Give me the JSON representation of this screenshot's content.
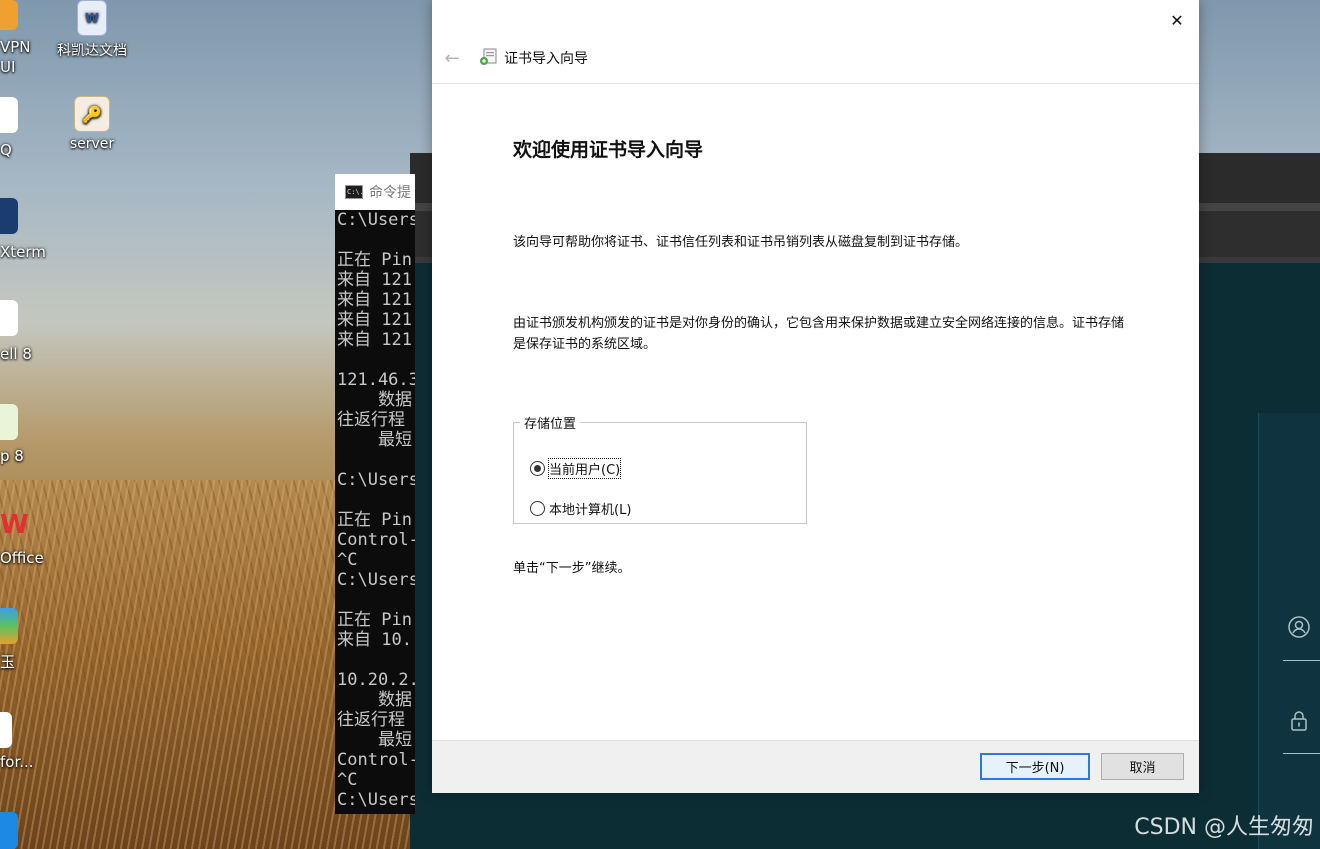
{
  "desktop": {
    "icons": [
      {
        "label": "科凯达文档",
        "icon": "word-document-icon"
      },
      {
        "label": "server",
        "icon": "certificate-file-icon"
      }
    ],
    "cut_labels": [
      "VPN",
      "UI",
      "Q",
      "Xterm",
      "ell 8",
      "p 8",
      "Office",
      "玉",
      "for..."
    ]
  },
  "console": {
    "title": "命令提",
    "icon_text": "C:\\.",
    "lines": [
      "C:\\Users",
      "",
      "正在 Pin",
      "来自 121",
      "来自 121",
      "来自 121",
      "来自 121",
      "",
      "121.46.3",
      "    数据",
      "往返行程",
      "    最短",
      "",
      "C:\\Users",
      "",
      "正在 Pin",
      "Control-",
      "^C",
      "C:\\Users",
      "",
      "正在 Pin",
      "来自 10.",
      "",
      "10.20.2.",
      "    数据",
      "往返行程",
      "    最短",
      "Control-",
      "^C",
      "C:\\Users"
    ]
  },
  "wizard": {
    "close_symbol": "✕",
    "back_symbol": "←",
    "nav_title": "证书导入向导",
    "heading": "欢迎使用证书导入向导",
    "paragraph1": "该向导可帮助你将证书、证书信任列表和证书吊销列表从磁盘复制到证书存储。",
    "paragraph2": "由证书颁发机构颁发的证书是对你身份的确认，它包含用来保护数据或建立安全网络连接的信息。证书存储是保存证书的系统区域。",
    "store_location": {
      "legend": "存储位置",
      "options": [
        {
          "label": "当前用户(C)",
          "selected": true
        },
        {
          "label": "本地计算机(L)",
          "selected": false
        }
      ]
    },
    "hint": "单击“下一步”继续。",
    "buttons": {
      "next": "下一步(N)",
      "cancel": "取消"
    },
    "accent_color": "#2b7bd6"
  },
  "watermark": "CSDN @人生匆匆"
}
